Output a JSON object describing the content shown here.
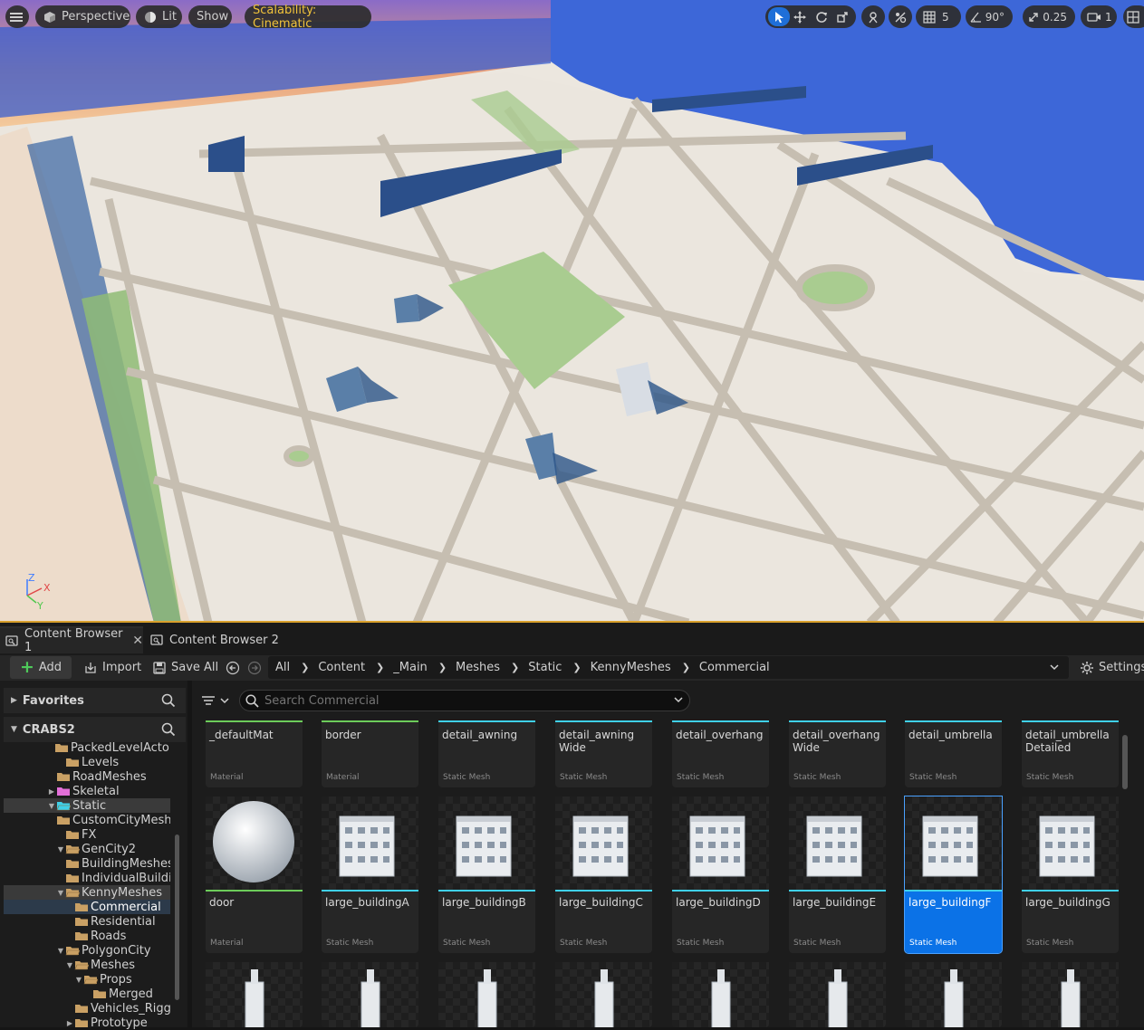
{
  "viewport": {
    "menu_icon": "hamburger-icon",
    "perspective_label": "Perspective",
    "lit_label": "Lit",
    "show_label": "Show",
    "scalability_label": "Scalability: Cinematic",
    "grid_size": "5",
    "angle_snap": "90°",
    "scale_snap": "0.25",
    "camera_speed": "1",
    "axis_labels": {
      "z": "Z",
      "x": "X",
      "y": "Y"
    },
    "colors": {
      "scalability_text": "#f0c23a",
      "active_tool": "#1f6fd8",
      "selection_border": "#d9a02c"
    }
  },
  "tabs": [
    {
      "label": "Content Browser 1",
      "active": true
    },
    {
      "label": "Content Browser 2",
      "active": false
    }
  ],
  "toolbar": {
    "add_label": "Add",
    "import_label": "Import",
    "save_all_label": "Save All",
    "settings_label": "Settings"
  },
  "breadcrumbs": [
    "All",
    "Content",
    "_Main",
    "Meshes",
    "Static",
    "KennyMeshes",
    "Commercial"
  ],
  "left_panel": {
    "favorites_label": "Favorites",
    "project_label": "CRABS2",
    "tree": [
      {
        "label": "PackedLevelActors",
        "indent": 0
      },
      {
        "label": "Levels",
        "indent": 1
      },
      {
        "label": "RoadMeshes",
        "indent": 0
      },
      {
        "label": "Skeletal",
        "indent": 0
      },
      {
        "label": "Static",
        "indent": 0
      },
      {
        "label": "CustomCityMeshes",
        "indent": 1
      },
      {
        "label": "FX",
        "indent": 1
      },
      {
        "label": "GenCity2",
        "indent": 1
      },
      {
        "label": "BuildingMeshes",
        "indent": 2
      },
      {
        "label": "IndividualBuildings",
        "indent": 2
      },
      {
        "label": "KennyMeshes",
        "indent": 1
      },
      {
        "label": "Commercial",
        "indent": 2
      },
      {
        "label": "Residential",
        "indent": 2
      },
      {
        "label": "Roads",
        "indent": 2
      },
      {
        "label": "PolygonCity",
        "indent": 1
      },
      {
        "label": "Meshes",
        "indent": 2
      },
      {
        "label": "Props",
        "indent": 3
      },
      {
        "label": "Merged",
        "indent": 4
      },
      {
        "label": "Vehicles_Rigged",
        "indent": 3
      },
      {
        "label": "Prototype",
        "indent": 2
      }
    ]
  },
  "search": {
    "placeholder": "Search Commercial"
  },
  "assets_row1": [
    {
      "name": "_defaultMat",
      "type": "Material"
    },
    {
      "name": "border",
      "type": "Material"
    },
    {
      "name": "detail_awning",
      "type": "Static Mesh"
    },
    {
      "name": "detail_awning Wide",
      "type": "Static Mesh"
    },
    {
      "name": "detail_overhang",
      "type": "Static Mesh"
    },
    {
      "name": "detail_overhang Wide",
      "type": "Static Mesh"
    },
    {
      "name": "detail_umbrella",
      "type": "Static Mesh"
    },
    {
      "name": "detail_umbrella Detailed",
      "type": "Static Mesh"
    }
  ],
  "assets_row2": [
    {
      "name": "door",
      "type": "Material"
    },
    {
      "name": "large_buildingA",
      "type": "Static Mesh"
    },
    {
      "name": "large_buildingB",
      "type": "Static Mesh"
    },
    {
      "name": "large_buildingC",
      "type": "Static Mesh"
    },
    {
      "name": "large_buildingD",
      "type": "Static Mesh"
    },
    {
      "name": "large_buildingE",
      "type": "Static Mesh"
    },
    {
      "name": "large_buildingF",
      "type": "Static Mesh"
    },
    {
      "name": "large_buildingG",
      "type": "Static Mesh"
    }
  ],
  "asset_colors": {
    "material": "#6ccc5a",
    "static_mesh": "#3fd0e8",
    "selected": "#0b72e7"
  }
}
